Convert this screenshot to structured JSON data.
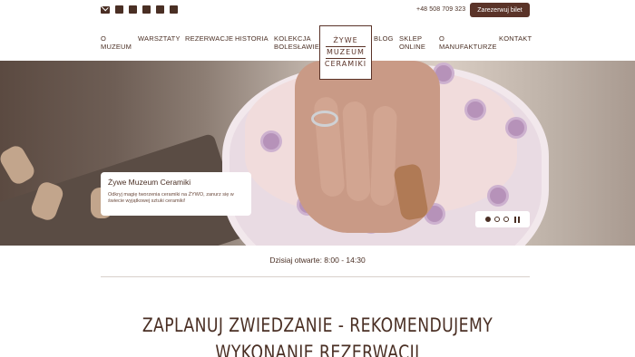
{
  "header": {
    "social_icons": [
      "mail-icon",
      "facebook-icon",
      "pinterest-icon",
      "instagram-icon",
      "blog-icon",
      "tripadvisor-icon"
    ],
    "phone": "+48 508 709 323",
    "reserve_button": "Zarezerwuj bilet"
  },
  "nav": {
    "items": [
      {
        "label": "O MUZEUM"
      },
      {
        "label": "WARSZTATY"
      },
      {
        "label": "REZERWACJE"
      },
      {
        "label": "HISTORIA"
      },
      {
        "label": "KOLEKCJA BOLESŁAWIEC"
      },
      {
        "label": "BLOG"
      },
      {
        "label": "SKLEP ONLINE"
      },
      {
        "label": "O MANUFAKTURZE"
      },
      {
        "label": "KONTAKT"
      }
    ],
    "logo": {
      "line1": "ŻYWE",
      "line2": "MUZEUM",
      "line3": "CERAMIKI"
    }
  },
  "hero": {
    "caption_title": "Żywe Muzeum Ceramiki",
    "caption_text": "Odkryj magię tworzenia ceramiki na ŻYWO, zanurz się w świecie wyjątkowej sztuki ceramiki!",
    "slides_count": 3,
    "active_slide": 1
  },
  "opening": {
    "text": "Dzisiaj otwarte: 8:00 - 14:30"
  },
  "main": {
    "headline_line1": "ZAPLANUJ ZWIEDZANIE - REKOMENDUJEMY",
    "headline_line2": "WYKONANIE REZERWACJI"
  },
  "colors": {
    "brand": "#5a3328",
    "text": "#4a2f24"
  }
}
